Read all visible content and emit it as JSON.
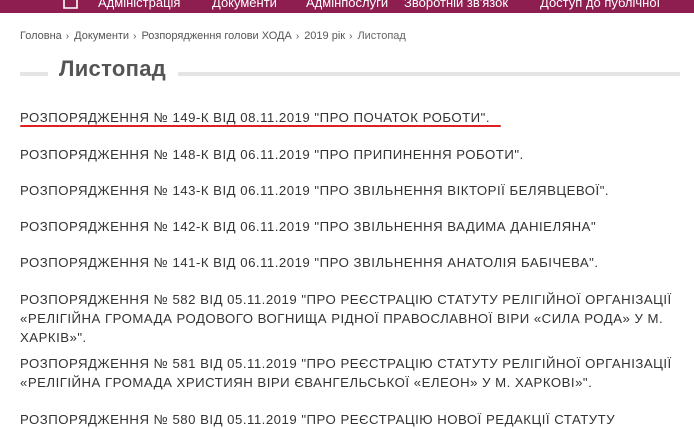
{
  "nav": {
    "items": [
      {
        "label": "Адміністрація"
      },
      {
        "label": "Документи"
      },
      {
        "label": "Адмінпослуги"
      },
      {
        "label": "Зворотній зв'язок"
      },
      {
        "label": "Доступ до публічної"
      }
    ]
  },
  "breadcrumb": {
    "items": [
      {
        "label": "Головна"
      },
      {
        "label": "Документи"
      },
      {
        "label": "Розпорядження голови ХОДА"
      },
      {
        "label": "2019 рік"
      }
    ],
    "current": "Листопад",
    "separator": "›"
  },
  "page": {
    "title": "Листопад"
  },
  "documents": [
    {
      "text": "РОЗПОРЯДЖЕННЯ № 149-К ВІД 08.11.2019 \"ПРО ПОЧАТОК РОБОТИ\"."
    },
    {
      "text": "РОЗПОРЯДЖЕННЯ № 148-К ВІД 06.11.2019 \"ПРО ПРИПИНЕННЯ РОБОТИ\"."
    },
    {
      "text": "РОЗПОРЯДЖЕННЯ № 143-К ВІД 06.11.2019 \"ПРО ЗВІЛЬНЕННЯ ВІКТОРІЇ БЕЛЯВЦЕВОЇ\"."
    },
    {
      "text": "РОЗПОРЯДЖЕННЯ № 142-К ВІД 06.11.2019 \"ПРО ЗВІЛЬНЕННЯ ВАДИМА ДАНІЕЛЯНА\""
    },
    {
      "text": "РОЗПОРЯДЖЕННЯ № 141-К ВІД 06.11.2019 \"ПРО ЗВІЛЬНЕННЯ АНАТОЛІЯ БАБІЧЕВА\"."
    },
    {
      "text": "РОЗПОРЯДЖЕННЯ № 582 ВІД 05.11.2019 \"ПРО РЕЄСТРАЦІЮ СТАТУТУ РЕЛІГІЙНОЇ ОРГАНІЗАЦІЇ «РЕЛІГІЙНА ГРОМАДА РОДОВОГО ВОГНИЩА РІДНОЇ ПРАВОСЛАВНОЇ ВІРИ «СИЛА РОДА» У М. ХАРКІВ»\"."
    },
    {
      "text": "РОЗПОРЯДЖЕННЯ № 581 ВІД 05.11.2019 \"ПРО РЕЄСТРАЦІЮ СТАТУТУ РЕЛІГІЙНОЇ ОРГАНІЗАЦІЇ «РЕЛІГІЙНА ГРОМАДА ХРИСТИЯН ВІРИ ЄВАНГЕЛЬСЬКОЇ «ЕЛЕОН» У М. ХАРКОВІ»\"."
    },
    {
      "text": "РОЗПОРЯДЖЕННЯ № 580 ВІД 05.11.2019 \"ПРО РЕЄСТРАЦІЮ НОВОЇ РЕДАКЦІЇ СТАТУТУ"
    }
  ],
  "colors": {
    "nav_background": "#8e1d50",
    "highlight_underline": "#e02020",
    "title_rule": "#e5e5e5"
  },
  "icons": {
    "home": "home-icon"
  }
}
